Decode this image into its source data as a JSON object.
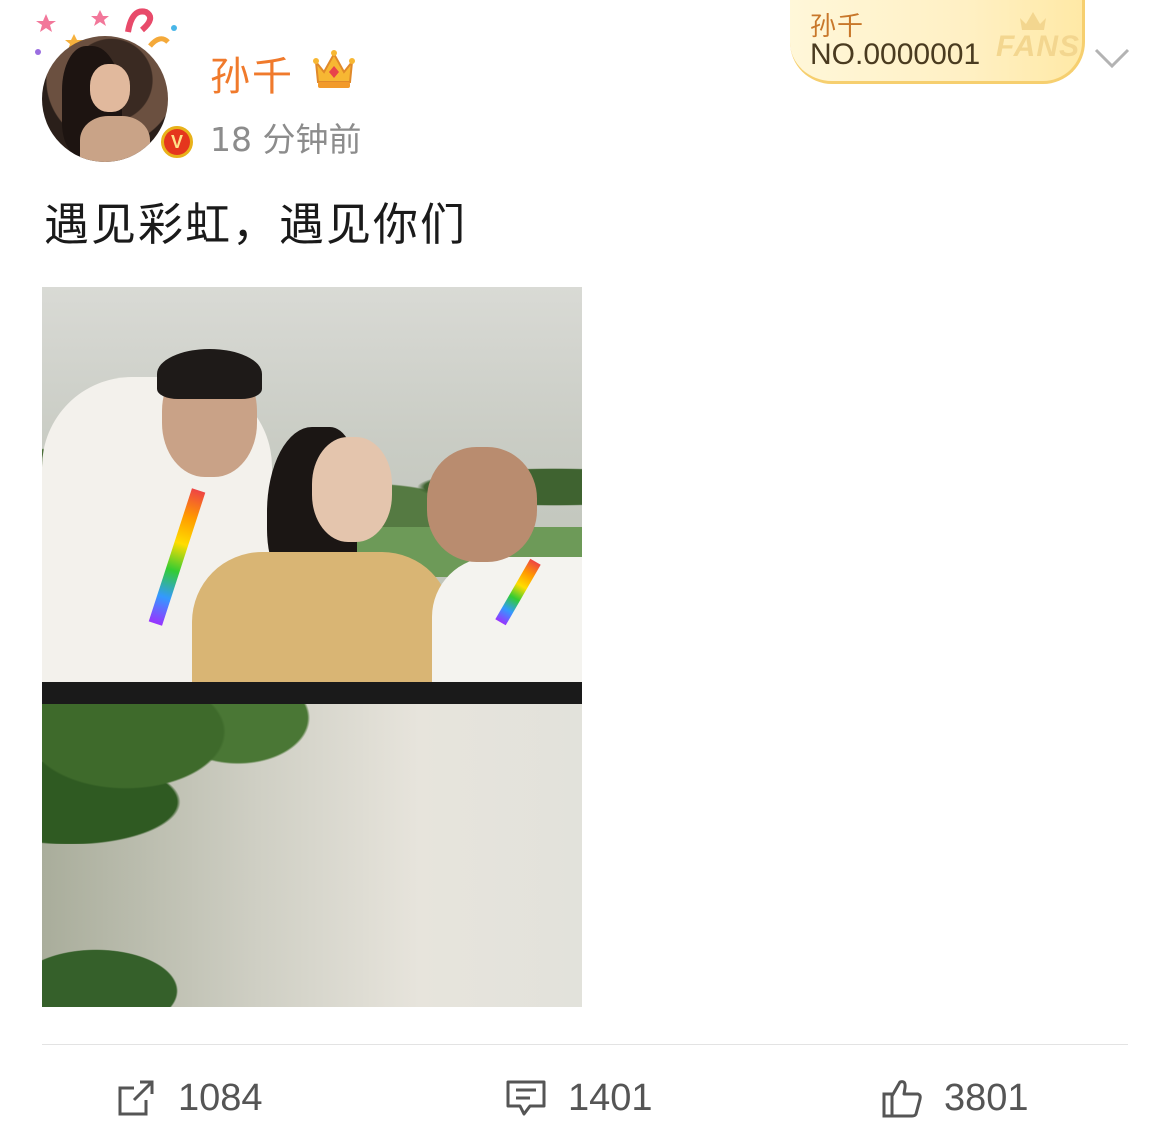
{
  "post": {
    "author": "孙千",
    "time": "18 分钟前",
    "text": "遇见彩虹，遇见你们",
    "verified_mark": "V"
  },
  "fans_badge": {
    "name": "孙千",
    "number": "NO.0000001",
    "label": "FANS"
  },
  "actions": {
    "repost_count": "1084",
    "comment_count": "1401",
    "like_count": "3801"
  },
  "colors": {
    "username": "#f07a2c",
    "time": "#8c8c8c",
    "badge": "#e8b21a"
  },
  "icons": [
    "avatar-decoration-icon",
    "crown-icon",
    "verified-icon",
    "chevron-down-icon",
    "repost-icon",
    "comment-icon",
    "like-icon"
  ]
}
